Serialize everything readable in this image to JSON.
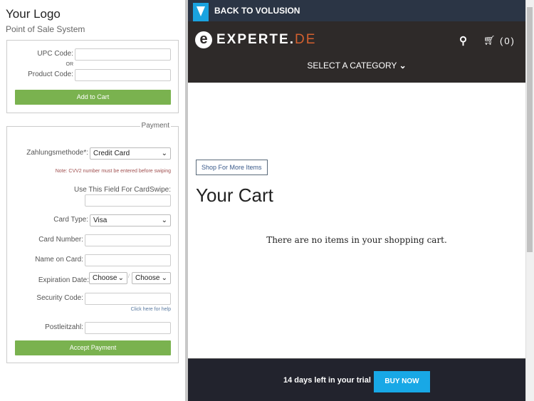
{
  "left": {
    "logo": "Your Logo",
    "subtitle": "Point of Sale System",
    "upc_label": "UPC Code:",
    "or": "OR",
    "product_label": "Product Code:",
    "add_to_cart": "Add to Cart",
    "payment_legend": "Payment",
    "method_label": "Zahlungsmethode*:",
    "method_value": "Credit Card",
    "note": "Note: CVV2 number must be entered before swiping",
    "swipe_label": "Use This Field For CardSwipe:",
    "card_type_label": "Card Type:",
    "card_type_value": "Visa",
    "card_number_label": "Card Number:",
    "name_label": "Name on Card:",
    "exp_label": "Expiration Date:",
    "exp_month": "Choose",
    "exp_sep": "/",
    "exp_year": "Choose",
    "security_label": "Security Code:",
    "help_link": "Click here for help",
    "zip_label": "Postleitzahl:",
    "accept": "Accept Payment"
  },
  "right": {
    "back": "BACK TO VOLUSION",
    "brand_main": "EXPERTE.",
    "brand_accent": "DE",
    "cart_count": "(0)",
    "category": "SELECT A CATEGORY",
    "shop_more": "Shop For More Items",
    "cart_title": "Your Cart",
    "empty": "There are no items in your shopping cart.",
    "trial": "14 days left in your trial",
    "buy": "BUY NOW"
  },
  "colors": {
    "green": "#7ab24f",
    "blue": "#18a8e6",
    "accent": "#d3602f"
  }
}
